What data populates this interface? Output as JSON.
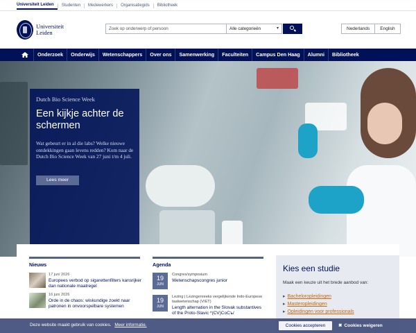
{
  "topbar": {
    "links": [
      {
        "label": "Universiteit Leiden",
        "active": true
      },
      {
        "label": "Studenten",
        "active": false
      },
      {
        "label": "Medewerkers",
        "active": false
      },
      {
        "label": "Organisatiegids",
        "active": false
      },
      {
        "label": "Bibliotheek",
        "active": false
      }
    ]
  },
  "header": {
    "logo_line1": "Universiteit",
    "logo_line2": "Leiden",
    "search_placeholder": "Zoek op onderwerp of persoon",
    "category_selected": "Alle categorieën",
    "search_icon": "search-icon",
    "languages": [
      "Nederlands",
      "English"
    ]
  },
  "nav": {
    "home_icon": "home-icon",
    "items": [
      "Onderzoek",
      "Onderwijs",
      "Wetenschappers",
      "Over ons",
      "Samenwerking",
      "Faculteiten",
      "Campus Den Haag",
      "Alumni",
      "Bibliotheek"
    ]
  },
  "hero": {
    "subtitle": "Dutch Bio Science Week",
    "title": "Een kijkje achter de schermen",
    "description": "Wat gebeurt er in al die labs? Welke nieuwe ontdekkingen gaan levens redden? Kom naar de Dutch Bio Science Week van 27 juni t/m 4 juli.",
    "button": "Lees meer"
  },
  "news": {
    "heading": "Nieuws",
    "items": [
      {
        "date": "17 juni 2026",
        "title": "Europees verbod op sigarettenfilters kansrijker dan nationale maatregel"
      },
      {
        "date": "16 juni 2026",
        "title": "Orde in de chaos: wiskundige zoekt naar patronen in onvoorspelbare systemen"
      }
    ]
  },
  "agenda": {
    "heading": "Agenda",
    "items": [
      {
        "day": "19",
        "month": "JUN",
        "category": "Congres/symposium",
        "title": "Wetenschapscongres junior"
      },
      {
        "day": "19",
        "month": "JUN",
        "category": "Lezing | Lezingenreeks vergelijkende Indo-Europese taalwetenschap (VIET)",
        "title": "Length alternation in the Slovak substantives of the Proto-Slavic *(CV)CoCъ/"
      }
    ]
  },
  "study": {
    "heading": "Kies een studie",
    "description": "Maak een keuze uit het brede aanbod van:",
    "links": [
      "Bacheloropleidingen",
      "Masteropleidingen",
      "Opleidingen voor professionals"
    ]
  },
  "cookie": {
    "message": "Deze website maakt gebruik van cookies.",
    "more": "Meer informatie.",
    "accept": "Cookies accepteren",
    "refuse": "Cookies weigeren",
    "refuse_icon": "close-icon"
  },
  "colors": {
    "brand_navy": "#001158",
    "link_orange": "#c6680d",
    "panel_grey": "#e7eaf0"
  }
}
